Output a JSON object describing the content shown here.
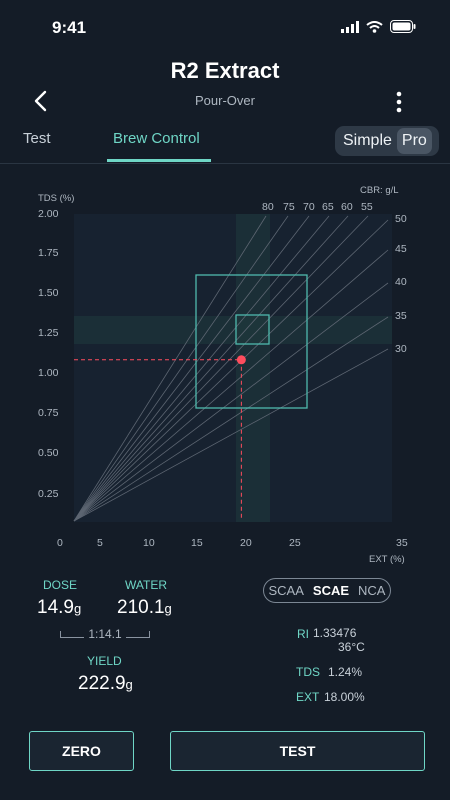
{
  "status_bar": {
    "time": "9:41"
  },
  "header": {
    "title": "R2 Extract",
    "subtitle": "Pour-Over"
  },
  "tabs": [
    {
      "label": "Test"
    },
    {
      "label": "Brew Control"
    }
  ],
  "mode_toggle": {
    "options": [
      "Simple",
      "Pro"
    ],
    "selected": "Pro"
  },
  "chart_data": {
    "type": "scatter",
    "y_title": "TDS (%)",
    "x_title": "EXT (%)",
    "cbr_title": "CBR: g/L",
    "y_ticks": [
      "2.00",
      "1.75",
      "1.50",
      "1.25",
      "1.00",
      "0.75",
      "0.50",
      "0.25"
    ],
    "x_ticks": [
      "0",
      "5",
      "10",
      "15",
      "20",
      "25",
      "35"
    ],
    "cbr_top": [
      "80",
      "75",
      "70",
      "65",
      "60",
      "55"
    ],
    "cbr_right": [
      "50",
      "45",
      "40",
      "35",
      "30"
    ],
    "point": {
      "ext": 19.9,
      "tds": 1.27
    },
    "point_color": "#ff4d5e",
    "line_color": "#4fb9ad"
  },
  "bottom": {
    "dose_label": "DOSE",
    "dose_value": "14.9",
    "dose_unit": "g",
    "water_label": "WATER",
    "water_value": "210.1",
    "water_unit": "g",
    "ratio": "1:14.1",
    "yield_label": "YIELD",
    "yield_value": "222.9",
    "yield_unit": "g",
    "standards": [
      "SCAA",
      "SCAE",
      "NCA"
    ],
    "standard_selected": "SCAE",
    "ri_label": "RI",
    "ri_value": "1.33476",
    "temp_value": "36°C",
    "tds_label": "TDS",
    "tds_value": "1.24%",
    "ext_label": "EXT",
    "ext_value": "18.00%",
    "zero_button": "ZERO",
    "test_button": "TEST"
  },
  "colors": {
    "accent": "#6fd6c6",
    "background": "#141c27"
  }
}
